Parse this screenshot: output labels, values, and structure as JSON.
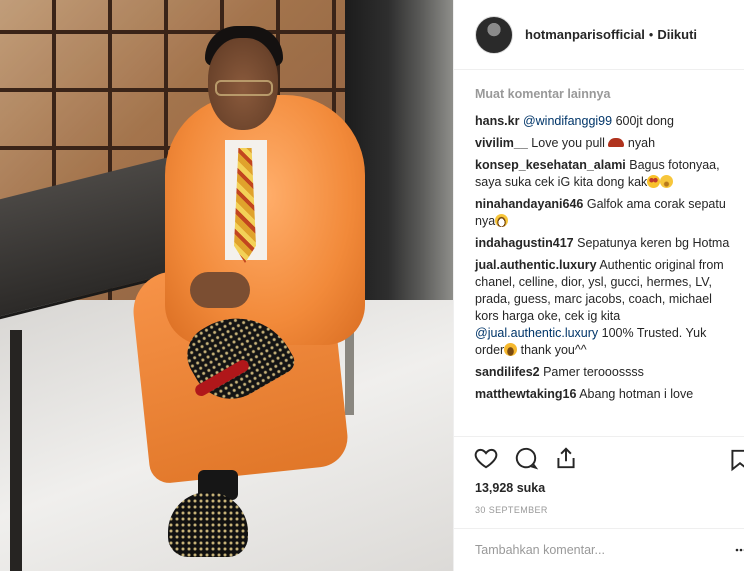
{
  "header": {
    "username": "hotmanparisofficial",
    "separator": "•",
    "follow_status": "Diikuti"
  },
  "comments_section": {
    "load_more": "Muat komentar lainnya",
    "comments": [
      {
        "user": "hans.kr",
        "mention": "@windifanggi99",
        "text": " 600jt dong"
      },
      {
        "user": "vivilim__",
        "text": " Love you pull ",
        "emoji": "shoe-emoji",
        "text_after": " nyah"
      },
      {
        "user": "konsep_kesehatan_alami",
        "text": " Bagus fotonyaa, saya suka cek iG kita dong kak",
        "emoji": "star-struck-emoji",
        "emoji2": "smile-emoji"
      },
      {
        "user": "ninahandayani646",
        "text": " Galfok ama corak sepatu nya",
        "emoji": "grin-emoji"
      },
      {
        "user": "indahagustin417",
        "text": " Sepatunya keren bg Hotma"
      },
      {
        "user": "jual.authentic.luxury",
        "text": " Authentic original from chanel, celline, dior, ysl, gucci, hermes, LV, prada, guess, marc jacobs, coach, michael kors harga oke, cek ig kita ",
        "mention": "@jual.authentic.luxury",
        "text_after": " 100% Trusted. Yuk order",
        "emoji": "laugh-emoji",
        "text_end": " thank you^^"
      },
      {
        "user": "sandilifes2",
        "text": " Pamer terooossss"
      },
      {
        "user": "matthewtaking16",
        "text": " Abang hotman i love"
      }
    ]
  },
  "actions": {
    "like_icon": "heart-icon",
    "comment_icon": "comment-icon",
    "share_icon": "share-icon",
    "save_icon": "bookmark-icon"
  },
  "likes": "13,928 suka",
  "date": "30 SEPTEMBER",
  "add_comment": {
    "placeholder": "Tambahkan komentar...",
    "more_icon": "more-options-icon"
  },
  "colors": {
    "link": "#003569",
    "muted": "#999999",
    "text": "#262626",
    "border": "#efefef"
  }
}
